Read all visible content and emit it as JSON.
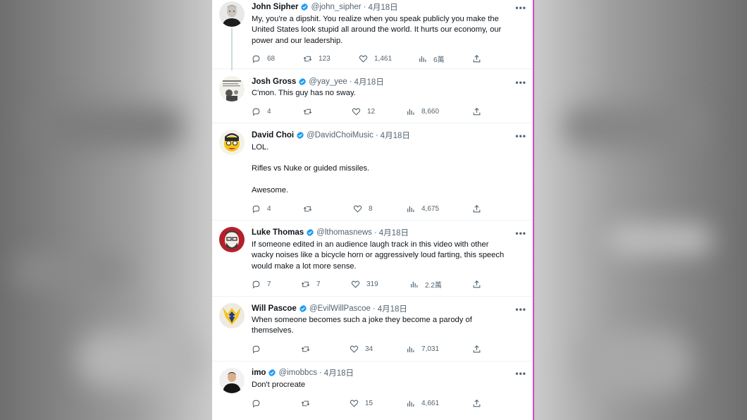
{
  "tweets": [
    {
      "name": "John Sipher",
      "handle": "@john_sipher",
      "date": "4月18日",
      "lines": [
        "My, you're a dipshit. You realize when you speak publicly you make the",
        "United States look stupid all around the world. It hurts our economy, our",
        "power and our leadership."
      ],
      "replies": "68",
      "retweets": "123",
      "likes": "1,461",
      "views": "6萬",
      "avatar": "john-sipher-avatar"
    },
    {
      "name": "Josh Gross",
      "handle": "@yay_yee",
      "date": "4月18日",
      "lines": [
        "C'mon. This guy has no sway."
      ],
      "replies": "4",
      "retweets": "",
      "likes": "12",
      "views": "8,660",
      "avatar": "josh-gross-avatar"
    },
    {
      "name": "David Choi",
      "handle": "@DavidChoiMusic",
      "date": "4月18日",
      "lines": [
        "LOL.",
        "Rifles vs Nuke or guided missiles.",
        "Awesome."
      ],
      "replies": "4",
      "retweets": "",
      "likes": "8",
      "views": "4,675",
      "avatar": "david-choi-avatar"
    },
    {
      "name": "Luke Thomas",
      "handle": "@lthomasnews",
      "date": "4月18日",
      "lines": [
        "If someone edited in an audience laugh track in this video with other",
        "wacky noises like a bicycle horn or aggressively loud farting, this speech",
        "would make a lot more sense."
      ],
      "replies": "7",
      "retweets": "7",
      "likes": "319",
      "views": "2.2萬",
      "avatar": "luke-thomas-avatar"
    },
    {
      "name": "Will Pascoe",
      "handle": "@EvilWillPascoe",
      "date": "4月18日",
      "lines": [
        "When someone becomes such a joke they become a parody of",
        "themselves."
      ],
      "replies": "",
      "retweets": "",
      "likes": "34",
      "views": "7,031",
      "avatar": "will-pascoe-avatar"
    },
    {
      "name": "imo",
      "handle": "@imobbcs",
      "date": "4月18日",
      "lines": [
        "Don't procreate"
      ],
      "replies": "",
      "retweets": "",
      "likes": "15",
      "views": "4,661",
      "avatar": "imo-avatar"
    }
  ],
  "colors": {
    "verified": "#1d9bf0",
    "text": "#0f1419",
    "secondary": "#536471",
    "panel_edge": "#d04ad6"
  },
  "icons": {
    "more": "more-horizontal-icon",
    "reply": "reply-icon",
    "retweet": "retweet-icon",
    "like": "heart-icon",
    "views": "views-chart-icon",
    "share": "share-icon",
    "verified": "verified-badge-icon"
  },
  "more_glyph": "•••"
}
